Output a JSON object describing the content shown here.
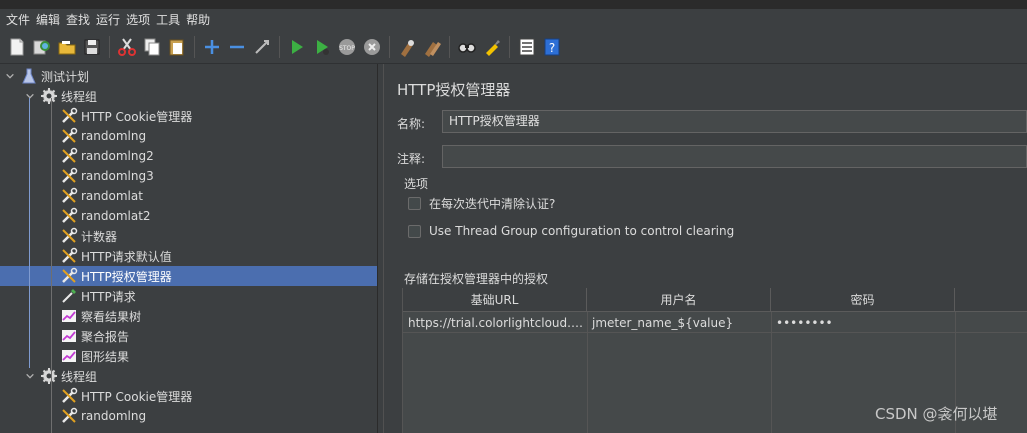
{
  "menu": [
    "文件",
    "编辑",
    "查找",
    "运行",
    "选项",
    "工具",
    "帮助"
  ],
  "toolbar_icons": [
    "new-icon",
    "templates-icon",
    "open-icon",
    "save-icon",
    "cut-icon",
    "copy-icon",
    "paste-icon",
    "expand-icon",
    "collapse-icon",
    "toggle-icon",
    "start-icon",
    "start-no-pause-icon",
    "stop-icon",
    "shutdown-icon",
    "clear-icon",
    "clear-all-icon",
    "search-icon",
    "reset-search-icon",
    "function-helper-icon",
    "help-icon"
  ],
  "tree": {
    "root": "测试计划",
    "group1": "线程组",
    "items1": [
      {
        "label": "HTTP Cookie管理器",
        "icon": "wrench-icon"
      },
      {
        "label": "randomlng",
        "icon": "wrench-icon"
      },
      {
        "label": "randomlng2",
        "icon": "wrench-icon"
      },
      {
        "label": "randomlng3",
        "icon": "wrench-icon"
      },
      {
        "label": "randomlat",
        "icon": "wrench-icon"
      },
      {
        "label": "randomlat2",
        "icon": "wrench-icon"
      },
      {
        "label": "计数器",
        "icon": "wrench-icon"
      },
      {
        "label": "HTTP请求默认值",
        "icon": "wrench-icon"
      },
      {
        "label": "HTTP授权管理器",
        "icon": "wrench-icon"
      },
      {
        "label": "HTTP请求",
        "icon": "pipette-icon"
      },
      {
        "label": "察看结果树",
        "icon": "chart-icon"
      },
      {
        "label": "聚合报告",
        "icon": "chart-icon"
      },
      {
        "label": "图形结果",
        "icon": "chart-icon"
      }
    ],
    "group2": "线程组",
    "items2": [
      {
        "label": "HTTP Cookie管理器",
        "icon": "wrench-icon"
      },
      {
        "label": "randomlng",
        "icon": "wrench-icon"
      }
    ]
  },
  "panel": {
    "title": "HTTP授权管理器",
    "name_label": "名称:",
    "name_value": "HTTP授权管理器",
    "comment_label": "注释:",
    "comment_value": "",
    "options_label": "选项",
    "option1": "在每次迭代中清除认证?",
    "option2": "Use Thread Group configuration to control clearing",
    "auth_section_label": "存储在授权管理器中的授权",
    "columns": [
      "基础URL",
      "用户名",
      "密码"
    ],
    "row": {
      "url": "https://trial.colorlightcloud.co...",
      "username": "jmeter_name_${value}",
      "password": "••••••••"
    }
  },
  "watermark": "CSDN @衾何以堪"
}
